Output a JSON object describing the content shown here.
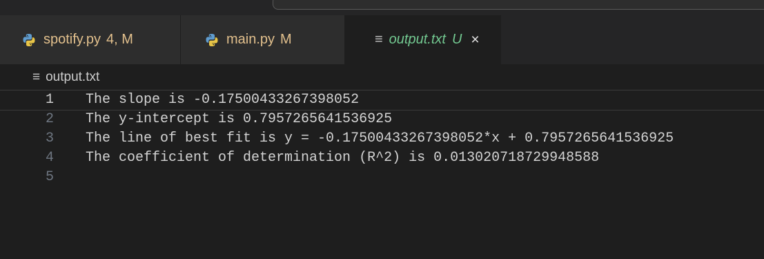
{
  "tabs": [
    {
      "name": "spotify.py",
      "badge": "4, M",
      "icon": "python-icon"
    },
    {
      "name": "main.py",
      "badge": "M",
      "icon": "python-icon"
    },
    {
      "name": "output.txt",
      "badge": "U",
      "icon": "text-file-icon",
      "close": "×"
    }
  ],
  "breadcrumb": {
    "icon": "≡",
    "file": "output.txt"
  },
  "tab_icon_glyph": "≡",
  "lines": [
    {
      "num": "1",
      "text": "The slope is -0.17500433267398052"
    },
    {
      "num": "2",
      "text": "The y-intercept is 0.7957265641536925"
    },
    {
      "num": "3",
      "text": "The line of best fit is y = -0.17500433267398052*x + 0.7957265641536925"
    },
    {
      "num": "4",
      "text": "The coefficient of determination (R^2) is 0.013020718729948588"
    },
    {
      "num": "5",
      "text": ""
    }
  ],
  "colors": {
    "modified": "#e2c08d",
    "untracked": "#73c991",
    "editor_bg": "#1e1e1e"
  }
}
